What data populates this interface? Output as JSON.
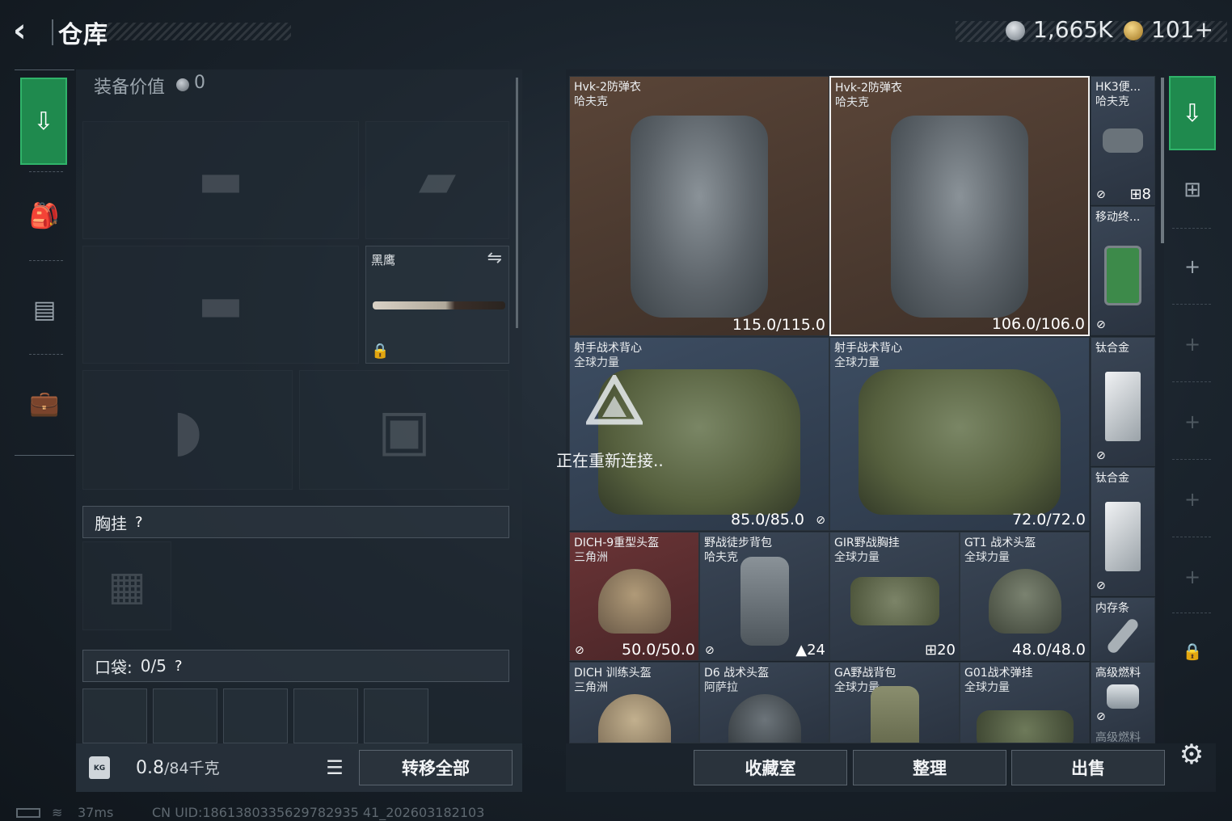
{
  "header": {
    "title": "仓库",
    "silver_amount": "1,665K",
    "gold_amount": "101+"
  },
  "left_tabs": [
    {
      "icon": "download-icon",
      "active": true
    },
    {
      "icon": "backpack-icon",
      "active": false
    },
    {
      "icon": "chest-rig-icon",
      "active": false
    },
    {
      "icon": "briefcase-icon",
      "active": false
    }
  ],
  "equipment": {
    "value_label": "装备价值",
    "value": "0",
    "melee_label": "黑鹰",
    "chest_rig_label": "胸挂",
    "pocket_label": "口袋:",
    "pocket_count": "0/5",
    "help": "?"
  },
  "footer_left": {
    "kg_badge": "KG",
    "weight_current": "0.8",
    "weight_max": "/84千克",
    "transfer_all": "转移全部"
  },
  "stash_items": [
    {
      "name": "Hvk-2防弹衣",
      "sub": "哈夫克",
      "durability": "115.0/115.0",
      "bg": "brown"
    },
    {
      "name": "Hvk-2防弹衣",
      "sub": "哈夫克",
      "durability": "106.0/106.0",
      "bg": "brown",
      "selected": true
    },
    {
      "name": "HK3便...",
      "sub": "哈夫克",
      "badge": "8"
    },
    {
      "name": "移动终...",
      "sub": ""
    },
    {
      "name": "射手战术背心",
      "sub": "全球力量",
      "durability": "85.0/85.0",
      "bg": "blue"
    },
    {
      "name": "射手战术背心",
      "sub": "全球力量",
      "durability": "72.0/72.0",
      "bg": "blue"
    },
    {
      "name": "钛合金",
      "sub": ""
    },
    {
      "name": "钛合金",
      "sub": ""
    },
    {
      "name": "DICH-9重型头盔",
      "sub": "三角洲",
      "durability": "50.0/50.0",
      "bg": "red"
    },
    {
      "name": "野战徒步背包",
      "sub": "哈夫克",
      "badge": "24"
    },
    {
      "name": "GIR野战胸挂",
      "sub": "全球力量",
      "badge": "20"
    },
    {
      "name": "GT1 战术头盔",
      "sub": "全球力量",
      "durability": "48.0/48.0"
    },
    {
      "name": "内存条",
      "sub": ""
    },
    {
      "name": "DICH 训练头盔",
      "sub": "三角洲"
    },
    {
      "name": "D6 战术头盔",
      "sub": "阿萨拉"
    },
    {
      "name": "GA野战背包",
      "sub": "全球力量"
    },
    {
      "name": "G01战术弹挂",
      "sub": "全球力量"
    },
    {
      "name": "高级燃料",
      "sub": ""
    },
    {
      "name": "高级燃料",
      "sub": ""
    }
  ],
  "overlay": {
    "reconnecting": "正在重新连接.."
  },
  "footer_right": {
    "collection": "收藏室",
    "organize": "整理",
    "sell": "出售"
  },
  "status_bar": {
    "ping": "37ms",
    "uid": "CN UID:1861380335629782935 41_202603182103"
  },
  "colors": {
    "accent_green": "#1f8a4e",
    "rarity_gold": "#5a4538",
    "rarity_blue": "#3d4d62",
    "rarity_red": "#6a3436"
  }
}
